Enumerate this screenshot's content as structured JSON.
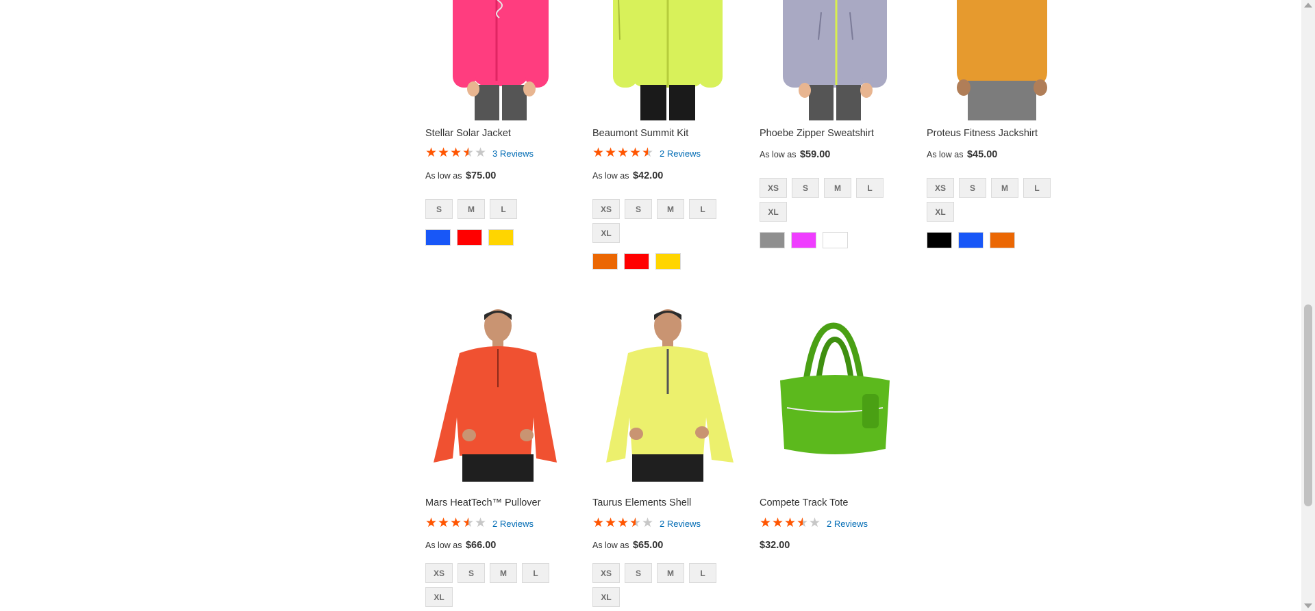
{
  "products": [
    {
      "name": "Stellar Solar Jacket",
      "image": "pink-jacket",
      "stars": [
        1,
        1,
        1,
        0.5,
        0
      ],
      "reviews": "3 Reviews",
      "price_prefix": "As low as",
      "price": "$75.00",
      "sizes": [
        "S",
        "M",
        "L"
      ],
      "colors": [
        {
          "name": "Blue",
          "hex": "#1857f7"
        },
        {
          "name": "Red",
          "hex": "#ff0000"
        },
        {
          "name": "Yellow",
          "hex": "#ffd500"
        }
      ]
    },
    {
      "name": "Beaumont Summit Kit",
      "image": "lime-jacket",
      "stars": [
        1,
        1,
        1,
        1,
        0.5
      ],
      "reviews": "2 Reviews",
      "price_prefix": "As low as",
      "price": "$42.00",
      "sizes": [
        "XS",
        "S",
        "M",
        "L",
        "XL"
      ],
      "colors": [
        {
          "name": "Orange",
          "hex": "#eb6703"
        },
        {
          "name": "Red",
          "hex": "#ff0000"
        },
        {
          "name": "Yellow",
          "hex": "#ffd500"
        }
      ]
    },
    {
      "name": "Phoebe Zipper Sweatshirt",
      "image": "gray-sweatshirt",
      "stars": [],
      "reviews": "",
      "price_prefix": "As low as",
      "price": "$59.00",
      "sizes": [
        "XS",
        "S",
        "M",
        "L",
        "XL"
      ],
      "colors": [
        {
          "name": "Gray",
          "hex": "#8f8f8f"
        },
        {
          "name": "Purple",
          "hex": "#ef3dff"
        },
        {
          "name": "White",
          "hex": "#ffffff"
        }
      ]
    },
    {
      "name": "Proteus Fitness Jackshirt",
      "image": "orange-jackshirt",
      "stars": [],
      "reviews": "",
      "price_prefix": "As low as",
      "price": "$45.00",
      "sizes": [
        "XS",
        "S",
        "M",
        "L",
        "XL"
      ],
      "colors": [
        {
          "name": "Black",
          "hex": "#000000"
        },
        {
          "name": "Blue",
          "hex": "#1857f7"
        },
        {
          "name": "Orange",
          "hex": "#eb6703"
        }
      ]
    },
    {
      "name": "Mars HeatTech™ Pullover",
      "image": "red-pullover",
      "stars": [
        1,
        1,
        1,
        0.5,
        0
      ],
      "reviews": "2 Reviews",
      "price_prefix": "As low as",
      "price": "$66.00",
      "sizes": [
        "XS",
        "S",
        "M",
        "L",
        "XL"
      ],
      "colors": []
    },
    {
      "name": "Taurus Elements Shell",
      "image": "yellow-shell",
      "stars": [
        1,
        1,
        1,
        0.5,
        0
      ],
      "reviews": "2 Reviews",
      "price_prefix": "As low as",
      "price": "$65.00",
      "sizes": [
        "XS",
        "S",
        "M",
        "L",
        "XL"
      ],
      "colors": []
    },
    {
      "name": "Compete Track Tote",
      "image": "green-tote-bag",
      "stars": [
        1,
        1,
        1,
        0.5,
        0
      ],
      "reviews": "2 Reviews",
      "price_prefix": "",
      "price": "$32.00",
      "sizes": [],
      "colors": []
    }
  ]
}
